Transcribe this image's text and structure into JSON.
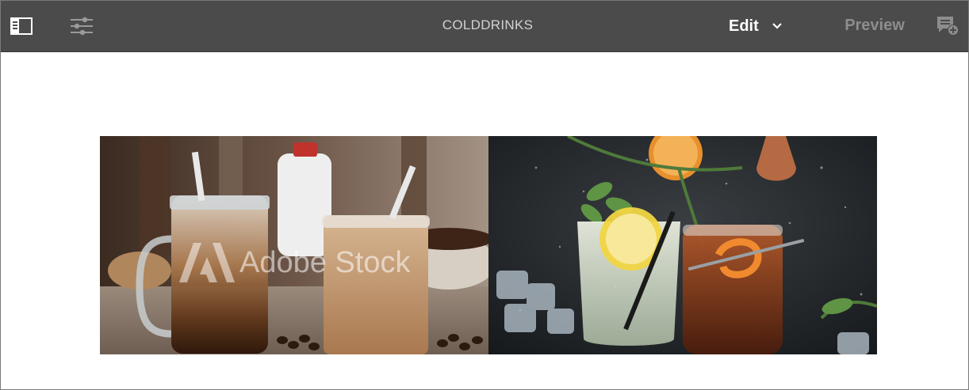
{
  "toolbar": {
    "side_panel_icon": "side-panel-icon",
    "properties_icon": "page-properties-sliders-icon",
    "page_title": "COLDDRINKS",
    "mode": {
      "label": "Edit",
      "icon": "chevron-down-icon"
    },
    "preview_label": "Preview",
    "annotate_icon": "add-annotation-icon"
  },
  "content": {
    "images": [
      {
        "subject": "iced coffee in mason jar and glass with coffee beans",
        "watermark": "Adobe Stock"
      },
      {
        "subject": "cocktails with lemon, mint, orange peel and ice on dark background"
      }
    ]
  },
  "colors": {
    "toolbar_bg": "#4b4b4b",
    "toolbar_text": "#d2d2d2",
    "preview_text": "#8d8d8d"
  }
}
